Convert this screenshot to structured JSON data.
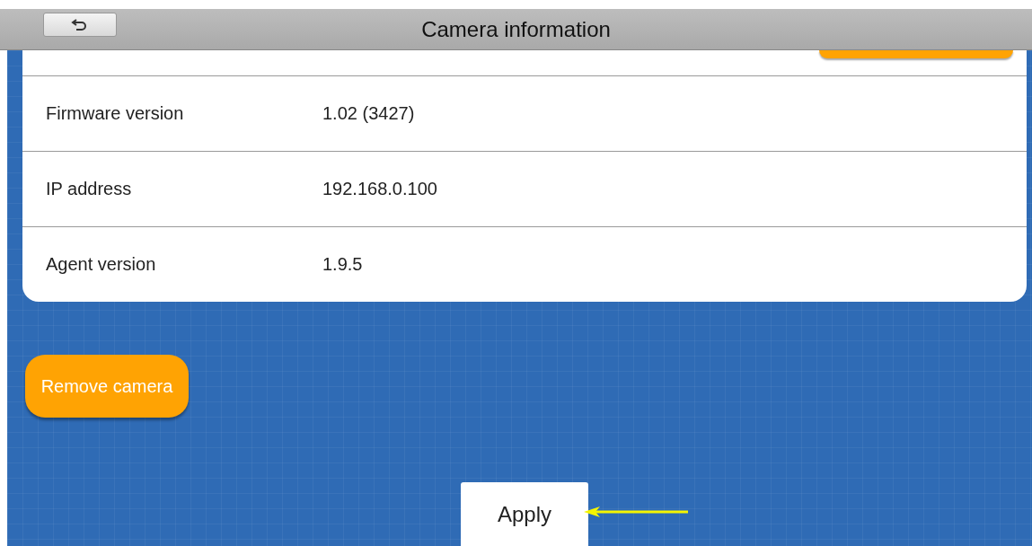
{
  "header": {
    "title": "Camera information"
  },
  "info_rows": [
    {
      "label": "Firmware version",
      "value": "1.02 (3427)"
    },
    {
      "label": "IP address",
      "value": "192.168.0.100"
    },
    {
      "label": "Agent version",
      "value": "1.9.5"
    }
  ],
  "buttons": {
    "remove": "Remove camera",
    "apply": "Apply"
  }
}
